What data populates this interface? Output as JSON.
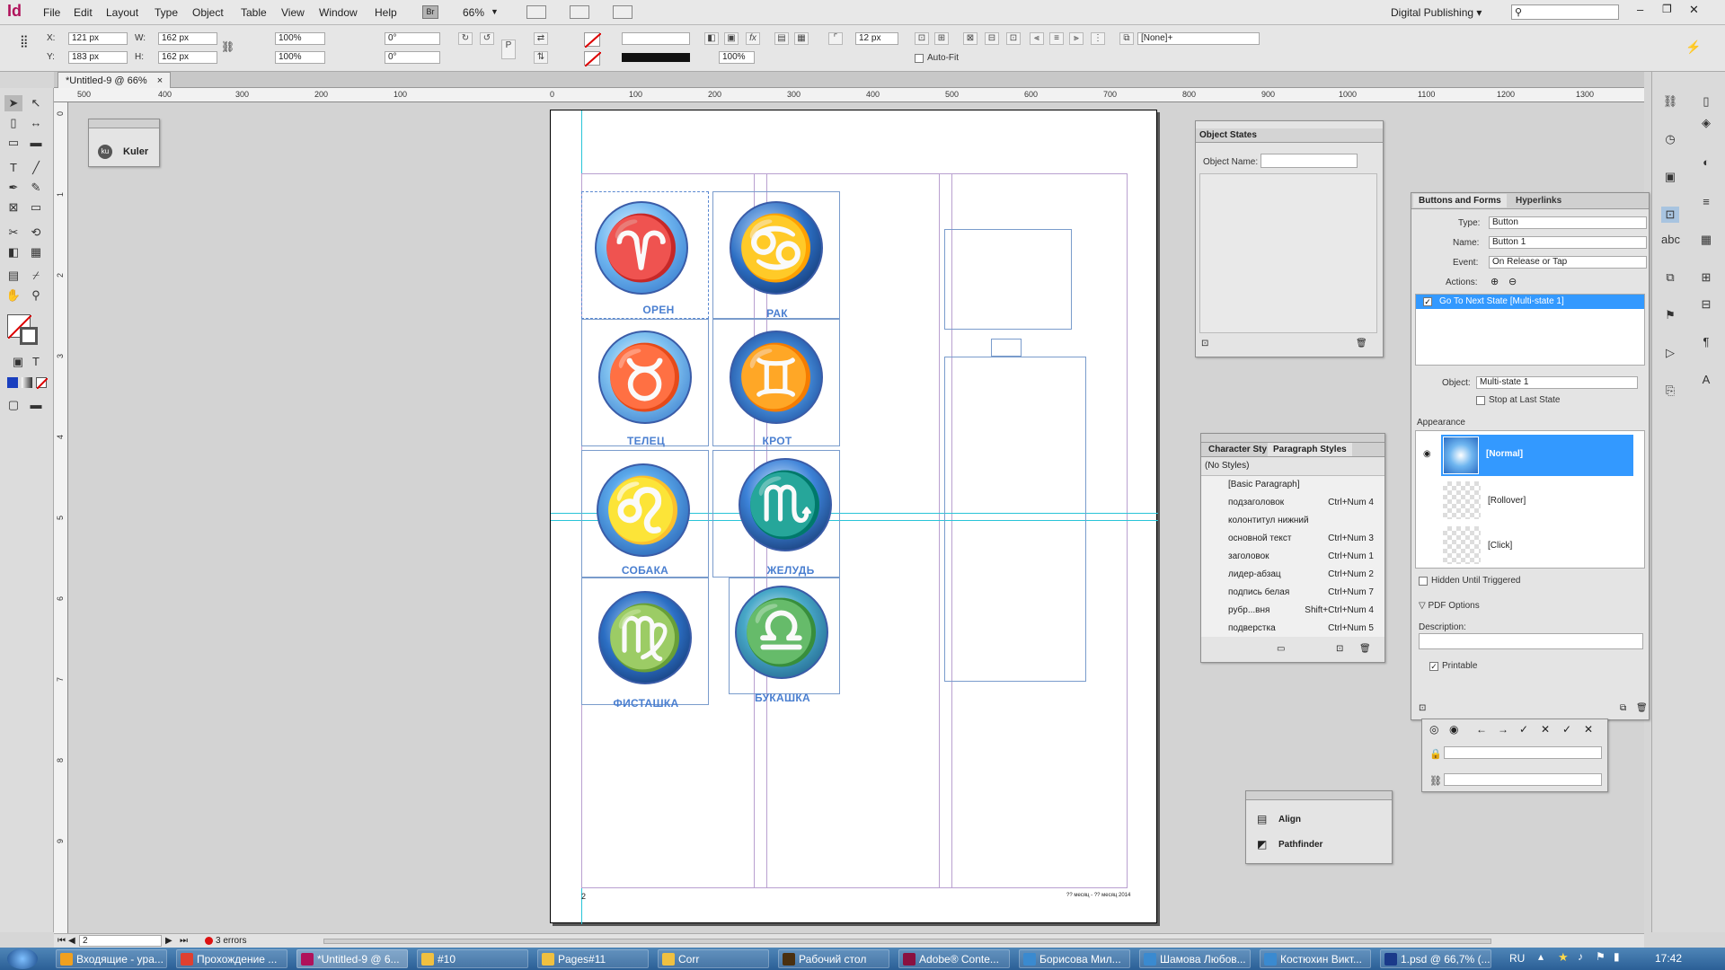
{
  "app": {
    "logo": "Id",
    "workspace": "Digital Publishing ▾",
    "zoom": "66%"
  },
  "menu": [
    "File",
    "Edit",
    "Layout",
    "Type",
    "Object",
    "Table",
    "View",
    "Window",
    "Help"
  ],
  "bridge_label": "Br",
  "control": {
    "x": "121 px",
    "y": "183 px",
    "w": "162 px",
    "h": "162 px",
    "scale_x": "100%",
    "scale_y": "100%",
    "rotate": "0°",
    "shear": "0°",
    "stroke_weight": "12 px",
    "opacity": "100%",
    "autofit": "Auto-Fit",
    "object_style": "[None]+"
  },
  "doc_tab": "*Untitled-9 @ 66%",
  "ruler_h": [
    "500",
    "400",
    "300",
    "200",
    "100",
    "0",
    "100",
    "200",
    "300",
    "400",
    "500",
    "600",
    "700",
    "800",
    "900",
    "1000",
    "1100",
    "1200",
    "1300"
  ],
  "ruler_v": [
    "0",
    "1",
    "2",
    "3",
    "4",
    "5",
    "6",
    "7",
    "8",
    "9"
  ],
  "kuler": {
    "label": "Kuler",
    "icon": "ku"
  },
  "zodiac": [
    {
      "label": "ОРЕН",
      "glyph": "♈"
    },
    {
      "label": "РАК",
      "glyph": "♋"
    },
    {
      "label": "ТЕЛЕЦ",
      "glyph": "♉"
    },
    {
      "label": "КРОТ",
      "glyph": "♊"
    },
    {
      "label": "СОБАКА",
      "glyph": "♌"
    },
    {
      "label": "ЖЕЛУДЬ",
      "glyph": "♏"
    },
    {
      "label": "ФИСТАШКА",
      "glyph": "♍"
    },
    {
      "label": "БУКАШКА",
      "glyph": "♎"
    }
  ],
  "page_number": "2",
  "page_footer": "?? месяц - ?? месяц 2014",
  "object_states": {
    "title": "Object States",
    "name_label": "Object Name:"
  },
  "bf": {
    "tab1": "Buttons and Forms",
    "tab2": "Hyperlinks",
    "type_label": "Type:",
    "type_value": "Button",
    "name_label": "Name:",
    "name_value": "Button 1",
    "event_label": "Event:",
    "event_value": "On Release or Tap",
    "actions_label": "Actions:",
    "action_item": "Go To Next State [Multi-state 1]",
    "object_label": "Object:",
    "object_value": "Multi-state 1",
    "stop_label": "Stop at Last State",
    "appearance_label": "Appearance",
    "states": [
      "[Normal]",
      "[Rollover]",
      "[Click]"
    ],
    "hidden_label": "Hidden Until Triggered",
    "pdf_label": "PDF Options",
    "desc_label": "Description:",
    "printable_label": "Printable"
  },
  "styles": {
    "tab1": "Character Sty",
    "tab2": "Paragraph Styles",
    "current": "(No Styles)",
    "items": [
      {
        "name": "[Basic Paragraph]",
        "sc": ""
      },
      {
        "name": "подзаголовок",
        "sc": "Ctrl+Num 4"
      },
      {
        "name": "колонтитул нижний",
        "sc": ""
      },
      {
        "name": "основной текст",
        "sc": "Ctrl+Num 3"
      },
      {
        "name": "заголовок",
        "sc": "Ctrl+Num 1"
      },
      {
        "name": "лидер-абзац",
        "sc": "Ctrl+Num 2"
      },
      {
        "name": "подпись белая",
        "sc": "Ctrl+Num 7"
      },
      {
        "name": "рубр...вня",
        "sc": "Shift+Ctrl+Num 4"
      },
      {
        "name": "подверстка",
        "sc": "Ctrl+Num 5"
      }
    ]
  },
  "mini_panel": {
    "items": [
      "Align",
      "Pathfinder"
    ]
  },
  "status": {
    "page": "2",
    "errors": "3 errors"
  },
  "taskbar": {
    "items": [
      {
        "label": "Входящие - ypa...",
        "color": "#f0a020"
      },
      {
        "label": "Прохождение ...",
        "color": "#e04030"
      },
      {
        "label": "*Untitled-9 @ 6...",
        "color": "#b0125b"
      },
      {
        "label": "#10",
        "color": "#f0c040"
      },
      {
        "label": "Pages#11",
        "color": "#f0c040"
      },
      {
        "label": "Corr",
        "color": "#f0c040"
      },
      {
        "label": "Рабочий стол",
        "color": "#4a3010"
      },
      {
        "label": "Adobe® Conte...",
        "color": "#8a1040"
      },
      {
        "label": "Борисова Мил...",
        "color": "#3a8ad0"
      },
      {
        "label": "Шамова Любов...",
        "color": "#3a8ad0"
      },
      {
        "label": "Костюхин Викт...",
        "color": "#3a8ad0"
      },
      {
        "label": "1.psd @ 66,7% (...",
        "color": "#1a3a8a"
      }
    ],
    "lang": "RU",
    "time": "17:42"
  },
  "colors": {
    "accent": "#3399ff",
    "guide": "#29c4d8",
    "frame": "#7a9ccc"
  }
}
